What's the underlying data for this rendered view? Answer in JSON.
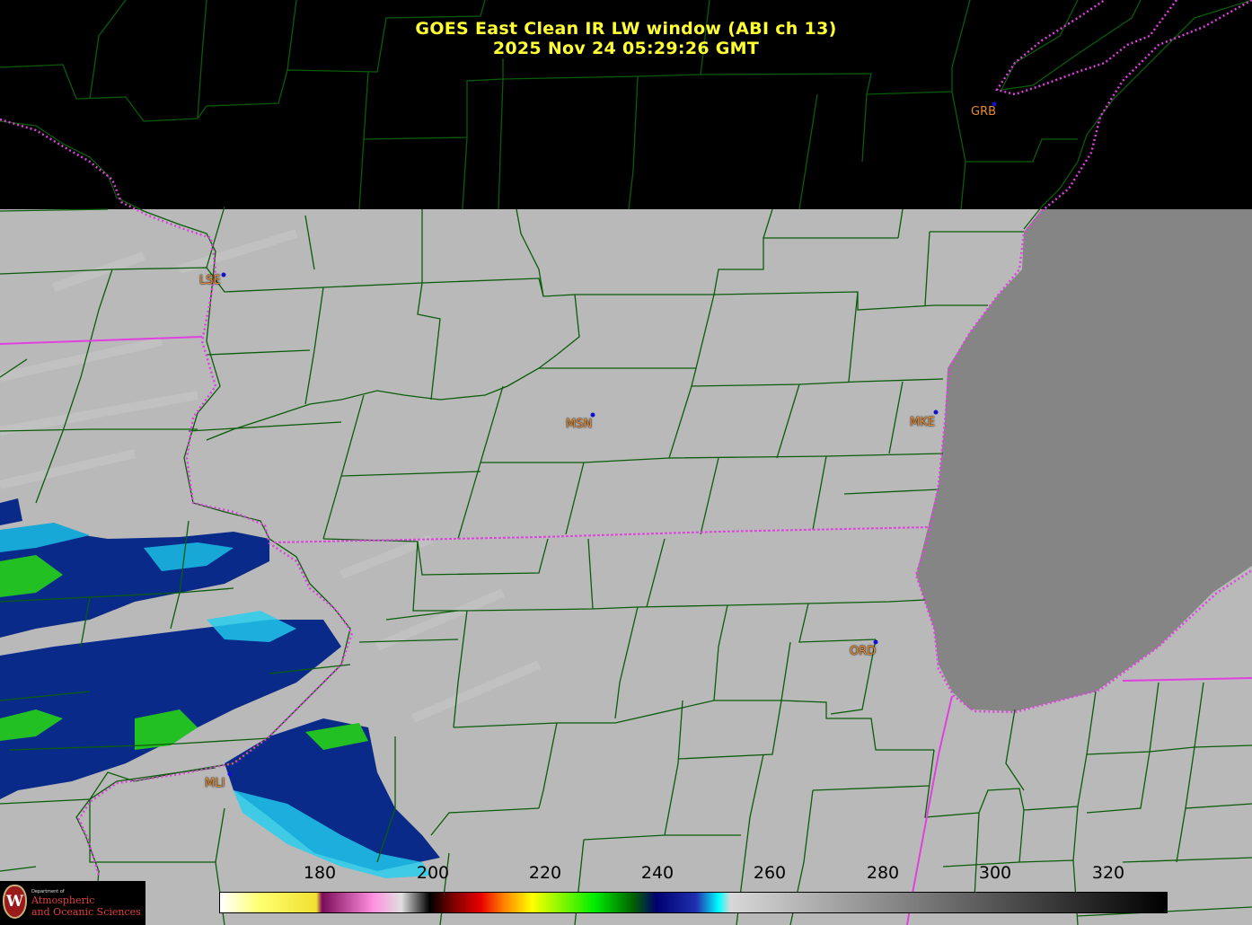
{
  "title": {
    "line1": "GOES East Clean IR LW window (ABI ch 13)",
    "line2": "2025 Nov 24  05:29:26 GMT"
  },
  "stations": [
    {
      "id": "GRB"
    },
    {
      "id": "LSE"
    },
    {
      "id": "MSN"
    },
    {
      "id": "MKE"
    },
    {
      "id": "ORD"
    },
    {
      "id": "MLI"
    }
  ],
  "colorbar": {
    "ticks": [
      "180",
      "200",
      "220",
      "240",
      "260",
      "280",
      "300",
      "320"
    ],
    "range": [
      163,
      330
    ],
    "stops": [
      {
        "v": 163,
        "c": "#ffffff"
      },
      {
        "v": 170,
        "c": "#ffff70"
      },
      {
        "v": 180,
        "c": "#f0e030"
      },
      {
        "v": 181,
        "c": "#7a0d5a"
      },
      {
        "v": 190,
        "c": "#ff90e0"
      },
      {
        "v": 195,
        "c": "#e0e0e0"
      },
      {
        "v": 200,
        "c": "#000000"
      },
      {
        "v": 204,
        "c": "#7a0000"
      },
      {
        "v": 209,
        "c": "#e80000"
      },
      {
        "v": 213,
        "c": "#ff8000"
      },
      {
        "v": 218,
        "c": "#ffff00"
      },
      {
        "v": 229,
        "c": "#00ee00"
      },
      {
        "v": 236,
        "c": "#006000"
      },
      {
        "v": 240,
        "c": "#000070"
      },
      {
        "v": 247,
        "c": "#2030b0"
      },
      {
        "v": 251,
        "c": "#00ffff"
      },
      {
        "v": 253,
        "c": "#d8d8d8"
      },
      {
        "v": 330,
        "c": "#000000"
      }
    ]
  },
  "logo": {
    "dept": "Department of",
    "line1": "Atmospheric",
    "line2": "and Oceanic Sciences"
  },
  "colors": {
    "county_lines": "#0a5c0a",
    "state_lines": "#e040e0",
    "title": "#ffff33",
    "station_label": "#e8892a",
    "lake": "#858585",
    "land_ir": "#b8b8b8"
  }
}
